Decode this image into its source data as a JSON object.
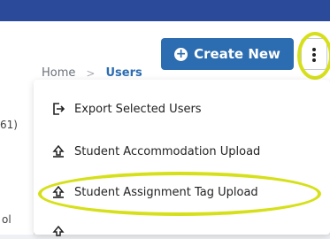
{
  "breadcrumb": {
    "home": "Home",
    "separator": ">",
    "current": "Users"
  },
  "toolbar": {
    "create_label": "Create New",
    "plus_glyph": "+"
  },
  "left_fragments": {
    "count": "61)",
    "cut_text": "ol"
  },
  "menu": {
    "items": [
      {
        "label": "Export Selected Users",
        "icon": "export-icon"
      },
      {
        "label": "Student Accommodation Upload",
        "icon": "upload-icon"
      },
      {
        "label": "Student Assignment Tag Upload",
        "icon": "upload-icon"
      }
    ]
  },
  "colors": {
    "topbar": "#2c4a9a",
    "accent": "#2c6cb0",
    "highlight": "#d6e01a"
  }
}
